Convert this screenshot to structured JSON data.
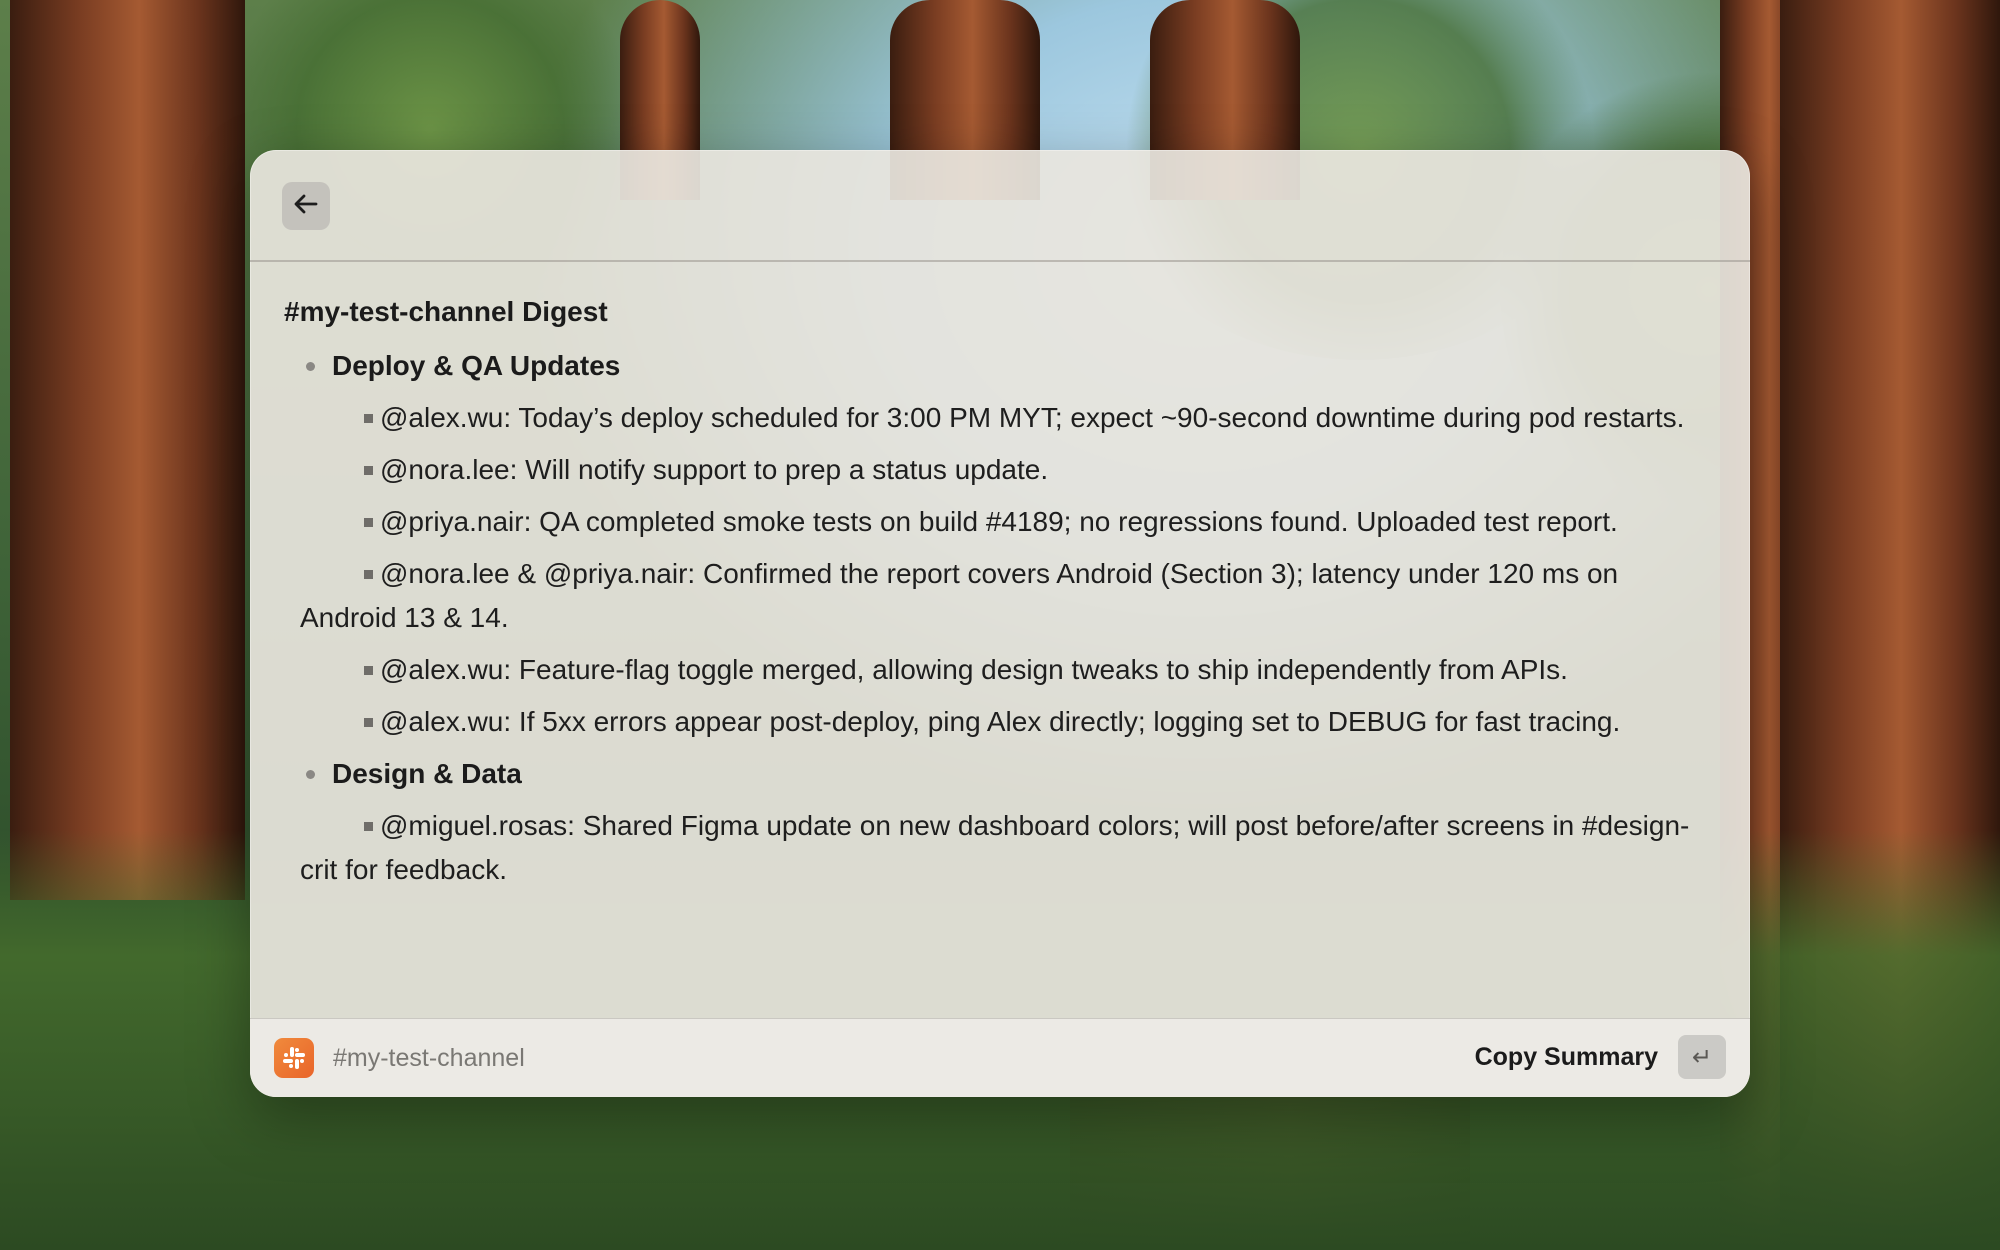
{
  "window": {
    "back_icon": "arrow-left-icon"
  },
  "digest": {
    "title": "#my-test-channel Digest",
    "sections": [
      {
        "heading": "Deploy & QA Updates",
        "items": [
          "@alex.wu: Today’s deploy scheduled for 3:00 PM MYT; expect ~90-second downtime during pod restarts.",
          "@nora.lee: Will notify support to prep a status update.",
          "@priya.nair: QA completed smoke tests on build #4189; no regressions found. Uploaded test report.",
          "@nora.lee & @priya.nair: Confirmed the report covers Android (Section 3); latency under 120 ms on Android 13 & 14.",
          "@alex.wu: Feature-flag toggle merged, allowing design tweaks to ship independently from APIs.",
          "@alex.wu: If 5xx errors appear post-deploy, ping Alex directly; logging set to DEBUG for fast tracing."
        ]
      },
      {
        "heading": "Design & Data",
        "items": [
          "@miguel.rosas: Shared Figma update on new dashboard colors; will post before/after screens in #design-crit for feedback."
        ]
      }
    ]
  },
  "footer": {
    "app_icon": "slack-icon",
    "channel": "#my-test-channel",
    "copy_label": "Copy Summary",
    "enter_key": "↵"
  },
  "colors": {
    "panel_bg": "#e8e5de",
    "app_icon_accent": "#ec7330"
  }
}
